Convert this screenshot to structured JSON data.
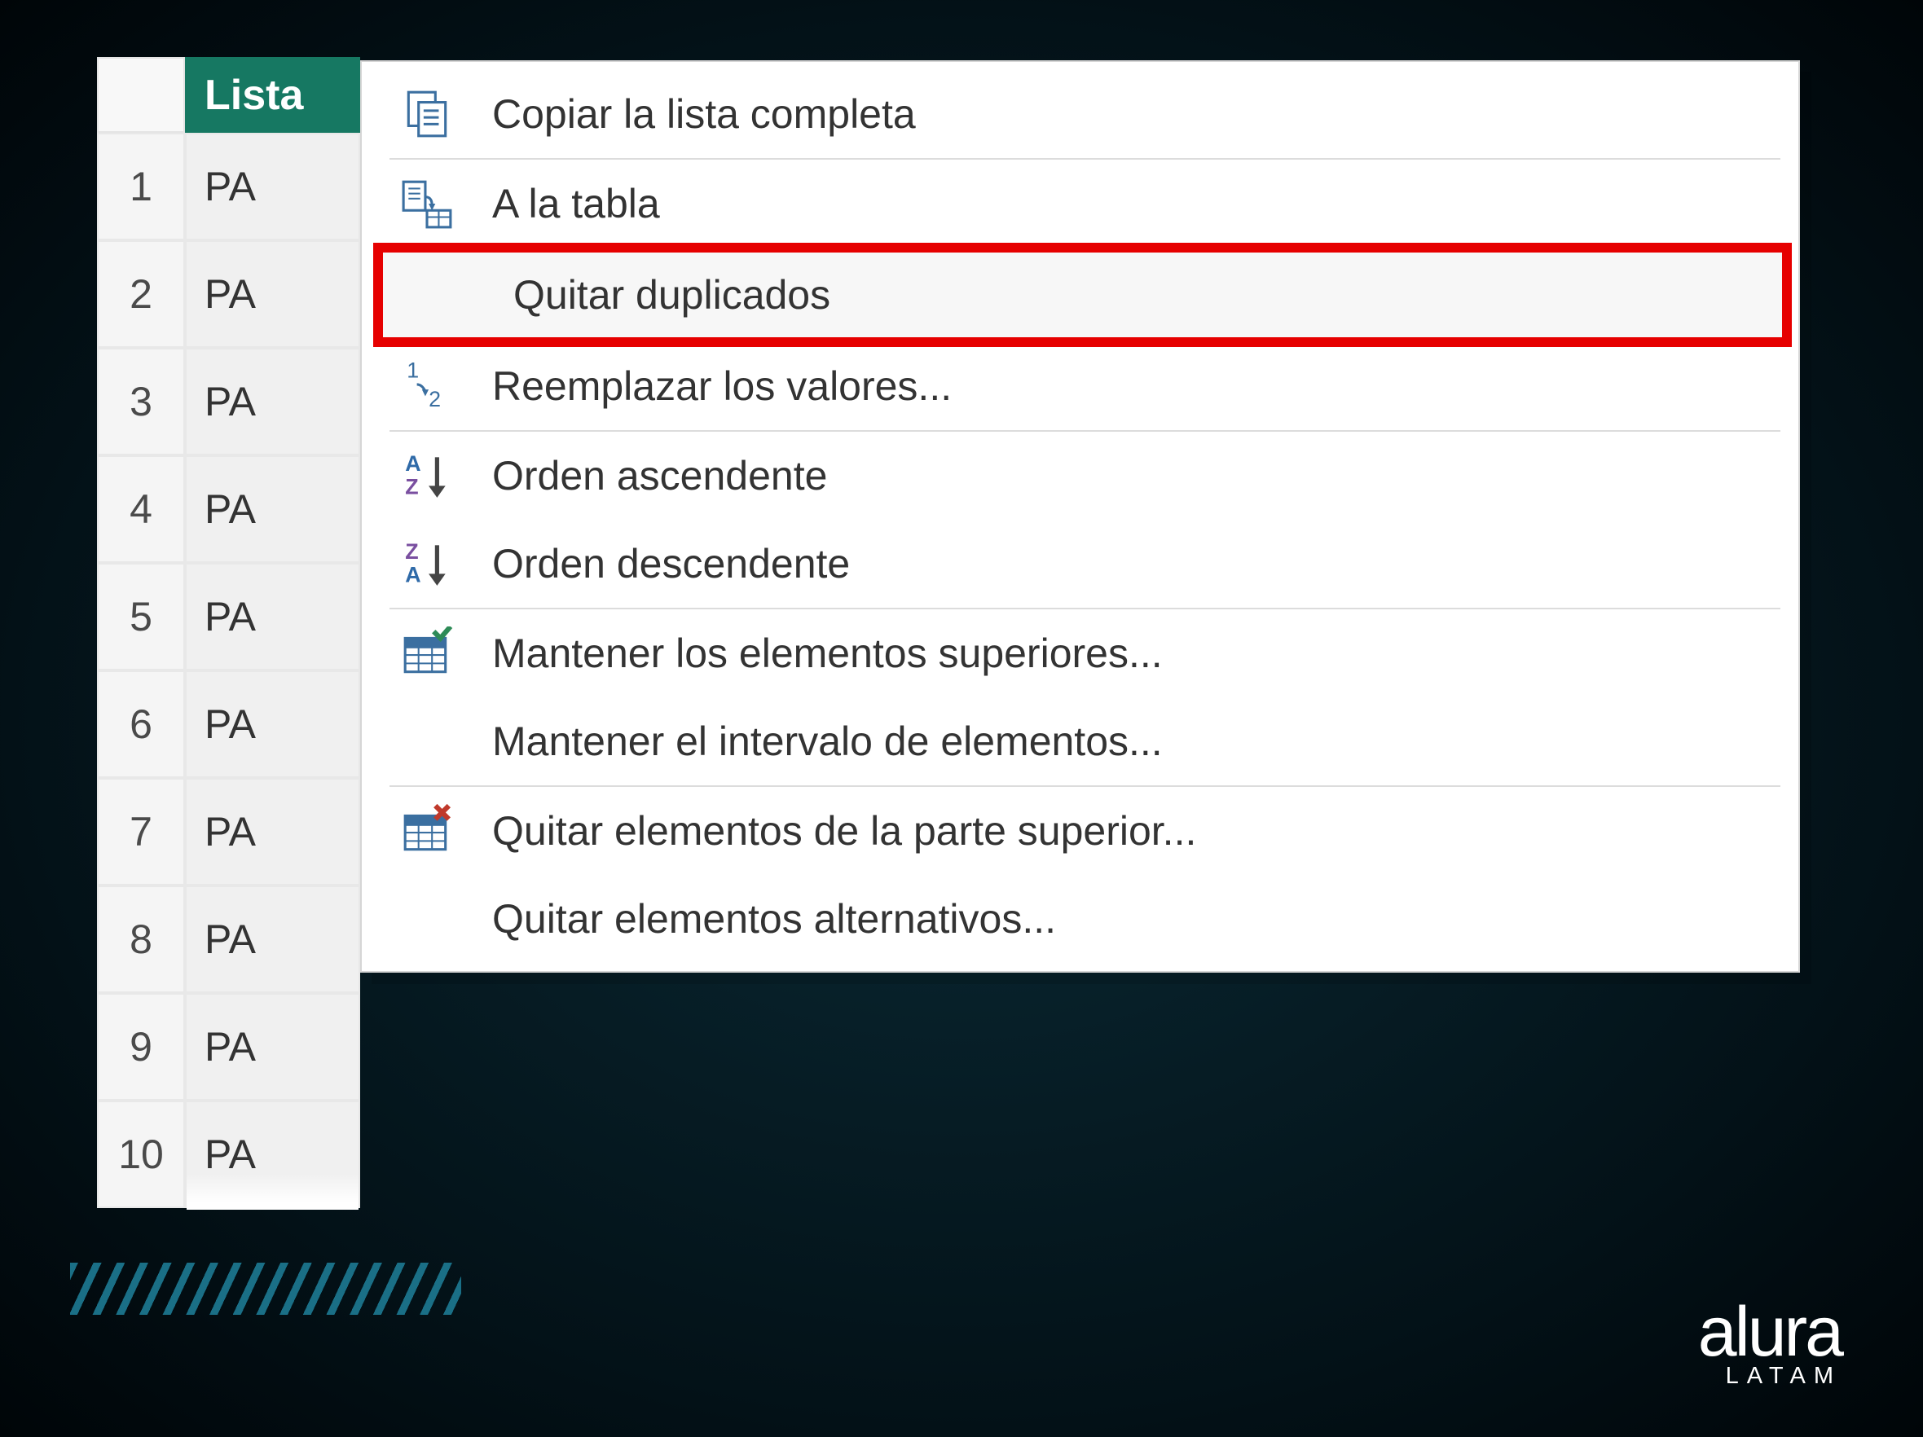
{
  "table": {
    "column_header": "Lista",
    "rows": [
      {
        "num": "1",
        "val": "PA"
      },
      {
        "num": "2",
        "val": "PA"
      },
      {
        "num": "3",
        "val": "PA"
      },
      {
        "num": "4",
        "val": "PA"
      },
      {
        "num": "5",
        "val": "PA"
      },
      {
        "num": "6",
        "val": "PA"
      },
      {
        "num": "7",
        "val": "PA"
      },
      {
        "num": "8",
        "val": "PA"
      },
      {
        "num": "9",
        "val": "PA"
      },
      {
        "num": "10",
        "val": "PA"
      }
    ]
  },
  "menu": {
    "copy_list": "Copiar la lista completa",
    "to_table": "A la tabla",
    "remove_dupes": "Quitar duplicados",
    "replace_values": "Reemplazar los valores...",
    "sort_asc": "Orden ascendente",
    "sort_desc": "Orden descendente",
    "keep_top": "Mantener los elementos superiores...",
    "keep_range": "Mantener el intervalo de elementos...",
    "remove_top": "Quitar elementos de la parte superior...",
    "remove_alt": "Quitar elementos alternativos..."
  },
  "brand": {
    "name": "alura",
    "region": "LATAM"
  }
}
